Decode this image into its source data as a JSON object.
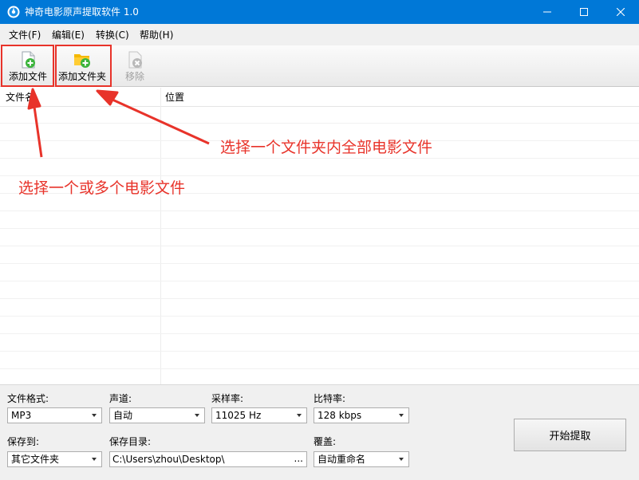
{
  "window": {
    "title": "神奇电影原声提取软件 1.0",
    "accent_color": "#0078d7",
    "icons": {
      "app": "app-logo-icon",
      "minimize": "minimize-icon",
      "maximize": "maximize-icon",
      "close": "close-icon"
    }
  },
  "menu": [
    {
      "label": "文件(F)"
    },
    {
      "label": "编辑(E)"
    },
    {
      "label": "转换(C)"
    },
    {
      "label": "帮助(H)"
    }
  ],
  "toolbar": {
    "add_file": {
      "label": "添加文件",
      "icon": "add-file-icon"
    },
    "add_folder": {
      "label": "添加文件夹",
      "icon": "add-folder-icon"
    },
    "remove": {
      "label": "移除",
      "icon": "remove-icon",
      "enabled": false
    }
  },
  "file_list": {
    "columns": [
      {
        "label": "文件名"
      },
      {
        "label": "位置"
      }
    ],
    "rows": []
  },
  "annotations": {
    "color": "#e8332a",
    "folder_hint": "选择一个文件夹内全部电影文件",
    "file_hint": "选择一个或多个电影文件"
  },
  "settings": {
    "format": {
      "label": "文件格式:",
      "value": "MP3"
    },
    "channel": {
      "label": "声道:",
      "value": "自动"
    },
    "sample_rate": {
      "label": "采样率:",
      "value": "11025 Hz"
    },
    "bitrate": {
      "label": "比特率:",
      "value": "128 kbps"
    },
    "save_to": {
      "label": "保存到:",
      "value": "其它文件夹"
    },
    "save_dir": {
      "label": "保存目录:",
      "value": "C:\\Users\\zhou\\Desktop\\",
      "browse": "..."
    },
    "overwrite": {
      "label": "覆盖:",
      "value": "自动重命名"
    }
  },
  "start_button": {
    "label": "开始提取"
  }
}
